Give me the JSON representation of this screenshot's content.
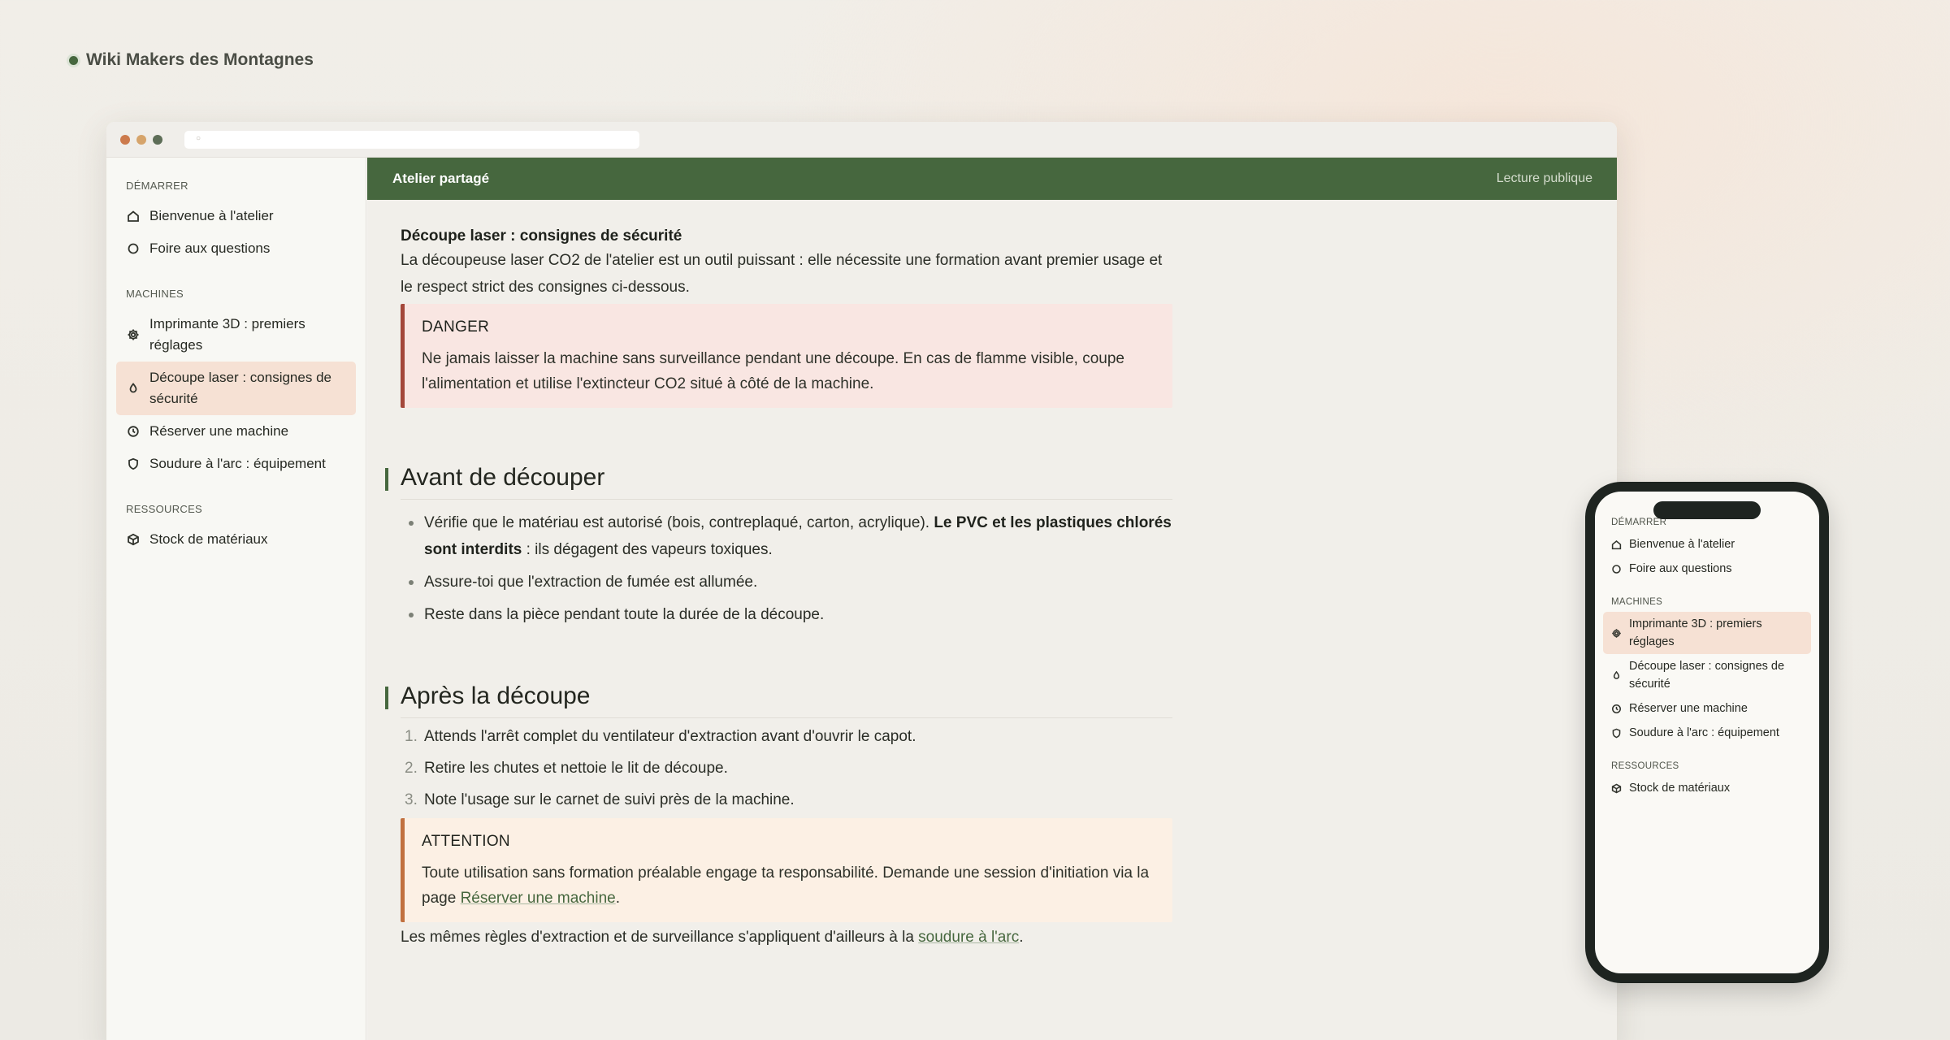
{
  "brand": {
    "name": "Wiki Makers des Montagnes"
  },
  "topbar": {
    "title": "Atelier partagé",
    "access": "Lecture publique"
  },
  "sidebar": {
    "sections": [
      {
        "title": "DÉMARRER",
        "items": [
          {
            "label": "Bienvenue à l'atelier",
            "icon": "home-icon"
          },
          {
            "label": "Foire aux questions",
            "icon": "circle-icon"
          }
        ]
      },
      {
        "title": "MACHINES",
        "items": [
          {
            "label": "Imprimante 3D : premiers réglages",
            "icon": "gear-icon"
          },
          {
            "label": "Découpe laser : consignes de sécurité",
            "icon": "flame-icon",
            "active": true
          },
          {
            "label": "Réserver une machine",
            "icon": "clock-icon"
          },
          {
            "label": "Soudure à l'arc : équipement",
            "icon": "shield-icon"
          }
        ]
      },
      {
        "title": "RESSOURCES",
        "items": [
          {
            "label": "Stock de matériaux",
            "icon": "box-icon"
          }
        ]
      }
    ]
  },
  "article": {
    "title": "Découpe laser : consignes de sécurité",
    "intro": "La découpeuse laser CO2 de l'atelier est un outil puissant : elle nécessite une formation avant premier usage et le respect strict des consignes ci-dessous.",
    "danger": {
      "title": "DANGER",
      "body": "Ne jamais laisser la machine sans surveillance pendant une découpe. En cas de flamme visible, coupe l'alimentation et utilise l'extincteur CO2 situé à côté de la machine."
    },
    "before": {
      "heading": "Avant de découper",
      "item1_text": "Vérifie que le matériau est autorisé (bois, contreplaqué, carton, acrylique).",
      "item1_strong": "Le PVC et les plastiques chlorés sont interdits",
      "item1_tail": ": ils dégagent des vapeurs toxiques.",
      "item2": "Assure-toi que l'extraction de fumée est allumée.",
      "item3": "Reste dans la pièce pendant toute la durée de la découpe."
    },
    "after": {
      "heading": "Après la découpe",
      "steps": [
        {
          "n": "1.",
          "text": "Attends l'arrêt complet du ventilateur d'extraction avant d'ouvrir le capot."
        },
        {
          "n": "2.",
          "text": "Retire les chutes et nettoie le lit de découpe."
        },
        {
          "n": "3.",
          "text": "Note l'usage sur le carnet de suivi près de la machine."
        }
      ]
    },
    "attention": {
      "title": "ATTENTION",
      "body": "Toute utilisation sans formation préalable engage ta responsabilité. Demande une session d'initiation via la page",
      "link": "Réserver une machine",
      "tail": "."
    },
    "closing": {
      "text": "Les mêmes règles d'extraction et de surveillance s'appliquent d'ailleurs à la",
      "link": "soudure à l'arc",
      "tail": "."
    }
  },
  "phone": {
    "sections": [
      {
        "title": "DÉMARRER",
        "items": [
          {
            "label": "Bienvenue à l'atelier",
            "icon": "home-icon"
          },
          {
            "label": "Foire aux questions",
            "icon": "circle-icon"
          }
        ]
      },
      {
        "title": "MACHINES",
        "items": [
          {
            "label": "Imprimante 3D : premiers réglages",
            "icon": "gear-icon",
            "active": true
          },
          {
            "label": "Découpe laser : consignes de sécurité",
            "icon": "flame-icon"
          },
          {
            "label": "Réserver une machine",
            "icon": "clock-icon"
          },
          {
            "label": "Soudure à l'arc : équipement",
            "icon": "shield-icon"
          }
        ]
      },
      {
        "title": "RESSOURCES",
        "items": [
          {
            "label": "Stock de matériaux",
            "icon": "box-icon"
          }
        ]
      }
    ]
  },
  "colors": {
    "accent": "#46673e",
    "active_bg": "#f6e1d4",
    "danger_border": "#a4473a",
    "warn_border": "#c1703f"
  }
}
